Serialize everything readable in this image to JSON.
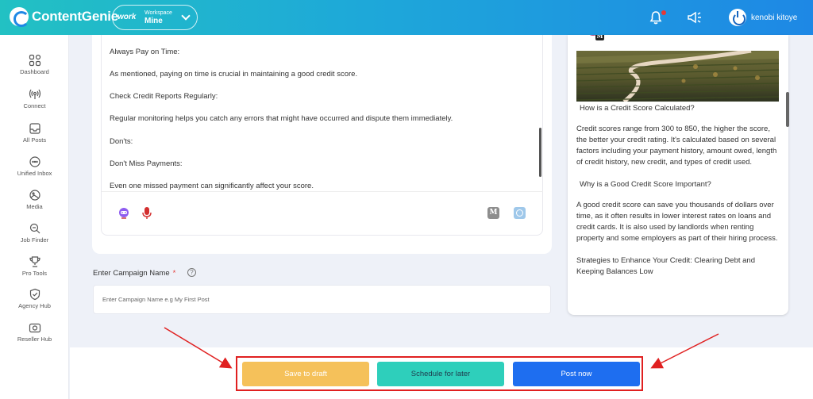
{
  "app": {
    "brand": "ContentGenie",
    "workspace_logo": "work",
    "workspace_label": "Workspace",
    "workspace_name": "Mine",
    "user_name": "kenobi kitoye",
    "accent_color": "#1e88e5"
  },
  "sidebar": {
    "items": [
      {
        "label": "Dashboard",
        "icon": "grid-icon"
      },
      {
        "label": "Connect",
        "icon": "broadcast-icon"
      },
      {
        "label": "All Posts",
        "icon": "inbox-icon"
      },
      {
        "label": "Unified Inbox",
        "icon": "chat-icon"
      },
      {
        "label": "Media",
        "icon": "media-icon"
      },
      {
        "label": "Job Finder",
        "icon": "search-icon"
      },
      {
        "label": "Pro Tools",
        "icon": "trophy-icon"
      },
      {
        "label": "Agency Hub",
        "icon": "shield-icon"
      },
      {
        "label": "Reseller Hub",
        "icon": "camera-icon"
      }
    ]
  },
  "editor": {
    "lines": [
      "Always Pay on Time:",
      "As mentioned, paying on time is crucial in maintaining a good credit score.",
      "Check Credit Reports Regularly:",
      "Regular monitoring helps you catch any errors that might have occurred and dispute them immediately.",
      " Don'ts:",
      "Don't Miss Payments:",
      "Even one missed payment can significantly affect your score."
    ],
    "medium_letter": "M"
  },
  "campaign": {
    "label": "Enter Campaign Name",
    "required_mark": "*",
    "help": "?",
    "placeholder": "Enter Campaign Name e.g My First Post"
  },
  "preview": {
    "badge": "M",
    "paragraphs": [
      "How is a Credit Score Calculated?",
      "Credit scores range from 300 to 850, the higher the score, the better your credit rating. It's calculated based on several factors including your payment history, amount owed, length of credit history, new credit, and types of credit used.",
      "Why is a Good Credit Score Important?",
      "A good credit score can save you thousands of dollars over time, as it often results in lower interest rates on loans and credit cards. It is also used by landlords when renting property and some employers as part of their hiring process.",
      "Strategies to Enhance Your Credit: Clearing Debt and Keeping Balances Low"
    ]
  },
  "actions": {
    "save_draft": "Save to draft",
    "schedule": "Schedule for later",
    "post_now": "Post now"
  }
}
